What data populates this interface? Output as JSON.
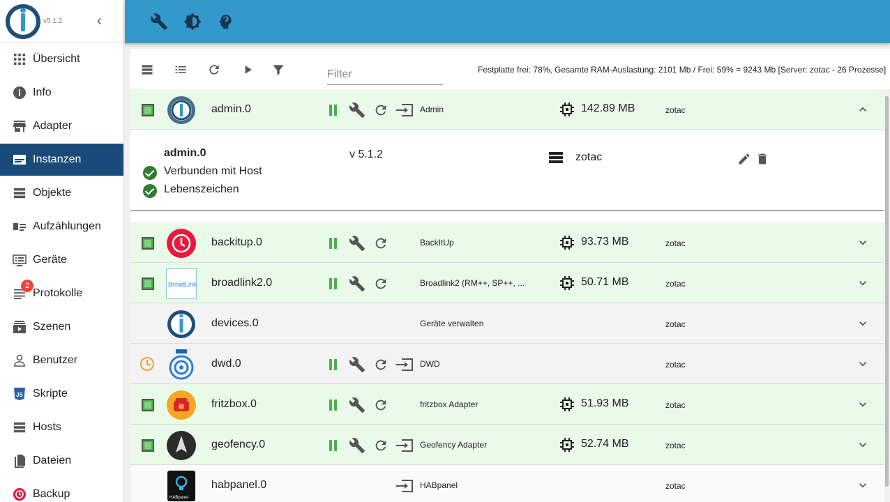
{
  "app": {
    "version": "v5.1.2"
  },
  "nav": [
    {
      "label": "Übersicht",
      "icon": "apps-icon"
    },
    {
      "label": "Info",
      "icon": "info-icon"
    },
    {
      "label": "Adapter",
      "icon": "store-icon"
    },
    {
      "label": "Instanzen",
      "icon": "instances-icon",
      "active": true
    },
    {
      "label": "Objekte",
      "icon": "list-icon"
    },
    {
      "label": "Aufzählungen",
      "icon": "enum-icon"
    },
    {
      "label": "Geräte",
      "icon": "devices-icon"
    },
    {
      "label": "Protokolle",
      "icon": "log-icon",
      "badge": "2"
    },
    {
      "label": "Szenen",
      "icon": "scenes-icon"
    },
    {
      "label": "Benutzer",
      "icon": "user-icon"
    },
    {
      "label": "Skripte",
      "icon": "js-icon"
    },
    {
      "label": "Hosts",
      "icon": "hosts-icon"
    },
    {
      "label": "Dateien",
      "icon": "files-icon"
    },
    {
      "label": "Backup",
      "icon": "backup-icon"
    }
  ],
  "toolbar": {
    "filter_placeholder": "Filter",
    "sysinfo": "Festplatte frei: 78%, Gesamte RAM-Auslastung: 2101 Mb / Frei: 59% = 9243 Mb [Server: zotac - 26 Prozesse]"
  },
  "expanded": {
    "name": "admin.0",
    "status1": "Verbunden mit Host",
    "status2": "Lebenszeichen",
    "version": "v 5.1.2",
    "host": "zotac"
  },
  "instances": [
    {
      "name": "admin.0",
      "title": "Admin",
      "memory": "142.89 MB",
      "host": "zotac",
      "state": "enabled",
      "open": true,
      "logo": "admin-logo-icon"
    },
    {
      "name": "backitup.0",
      "title": "BackItUp",
      "memory": "93.73 MB",
      "host": "zotac",
      "state": "enabled",
      "open": false,
      "logo": "backitup-logo-icon"
    },
    {
      "name": "broadlink2.0",
      "title": "Broadlink2 (RM++, SP++, ...",
      "memory": "50.71 MB",
      "host": "zotac",
      "state": "enabled",
      "open": false,
      "logo": "broadlink-logo-icon"
    },
    {
      "name": "devices.0",
      "title": "Geräte verwalten",
      "memory": "",
      "host": "zotac",
      "state": "none",
      "open": false,
      "logo": "iobroker-logo-icon"
    },
    {
      "name": "dwd.0",
      "title": "DWD",
      "memory": "",
      "host": "zotac",
      "state": "scheduled",
      "open": true,
      "logo": "dwd-logo-icon"
    },
    {
      "name": "fritzbox.0",
      "title": "fritzbox Adapter",
      "memory": "51.93 MB",
      "host": "zotac",
      "state": "enabled",
      "open": false,
      "logo": "fritzbox-logo-icon"
    },
    {
      "name": "geofency.0",
      "title": "Geofency Adapter",
      "memory": "52.74 MB",
      "host": "zotac",
      "state": "enabled",
      "open": true,
      "logo": "geofency-logo-icon"
    },
    {
      "name": "habpanel.0",
      "title": "HABpanel",
      "memory": "",
      "host": "zotac",
      "state": "none",
      "open": true,
      "logo": "habpanel-logo-icon",
      "logo_text": "HABpanel"
    }
  ],
  "colors": {
    "topbar": "#3399cc",
    "active_nav": "#194a7a",
    "running_row": "#e9fae9",
    "green": "#4caf50"
  }
}
